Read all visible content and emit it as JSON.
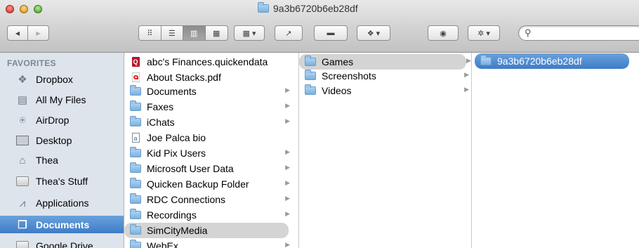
{
  "window": {
    "title": "9a3b6720b6eb28df"
  },
  "toolbar": {
    "back_icon": "◀",
    "forward_icon": "▶",
    "view_icon_label": "⠿",
    "view_list_label": "☰",
    "view_columns_label": "▥",
    "view_coverflow_label": "▦",
    "arrange_label": "▦ ▾",
    "share_label": "↗",
    "tag_label": "▬",
    "dropbox_label": "❖ ▾",
    "quicklook_label": "◉",
    "action_label": "✲ ▾",
    "search_placeholder": ""
  },
  "sidebar": {
    "header": "FAVORITES",
    "items": [
      {
        "label": "Dropbox",
        "icon": "dropbox-icon",
        "glyph": "❖"
      },
      {
        "label": "All My Files",
        "icon": "all-files-icon",
        "glyph": "▤"
      },
      {
        "label": "AirDrop",
        "icon": "airdrop-icon",
        "glyph": "⍟"
      },
      {
        "label": "Desktop",
        "icon": "desktop-icon",
        "glyph": ""
      },
      {
        "label": "Thea",
        "icon": "home-icon",
        "glyph": "⌂"
      },
      {
        "label": "Thea's Stuff",
        "icon": "folder-icon",
        "glyph": ""
      },
      {
        "label": "Applications",
        "icon": "applications-icon",
        "glyph": "⩘"
      },
      {
        "label": "Documents",
        "icon": "documents-icon",
        "glyph": "❐"
      },
      {
        "label": "Google Drive",
        "icon": "folder-icon",
        "glyph": ""
      }
    ]
  },
  "column1": {
    "items": [
      {
        "label": "abc's Finances.quickendata",
        "kind": "quicken",
        "arrow": false
      },
      {
        "label": "About Stacks.pdf",
        "kind": "pdf",
        "arrow": false
      },
      {
        "label": "Documents",
        "kind": "folder",
        "arrow": true
      },
      {
        "label": "Faxes",
        "kind": "folder",
        "arrow": true
      },
      {
        "label": "iChats",
        "kind": "folder",
        "arrow": true
      },
      {
        "label": "Joe Palca bio",
        "kind": "text",
        "arrow": false
      },
      {
        "label": "Kid Pix Users",
        "kind": "folder",
        "arrow": true
      },
      {
        "label": "Microsoft User Data",
        "kind": "folder",
        "arrow": true
      },
      {
        "label": "Quicken Backup Folder",
        "kind": "folder",
        "arrow": true
      },
      {
        "label": "RDC Connections",
        "kind": "folder",
        "arrow": true
      },
      {
        "label": "Recordings",
        "kind": "folder",
        "arrow": true
      },
      {
        "label": "SimCityMedia",
        "kind": "folder",
        "arrow": true
      },
      {
        "label": "WebEx",
        "kind": "folder",
        "arrow": true
      }
    ]
  },
  "column2": {
    "items": [
      {
        "label": "Games",
        "arrow": true
      },
      {
        "label": "Screenshots",
        "arrow": true
      },
      {
        "label": "Videos",
        "arrow": true
      }
    ]
  },
  "column3": {
    "items": [
      {
        "label": "9a3b6720b6eb28df",
        "arrow": false
      }
    ]
  },
  "colors": {
    "selection": "#3d7cc7",
    "highlight": "#d4d4d4",
    "sidebar_bg": "#dde4ec"
  }
}
